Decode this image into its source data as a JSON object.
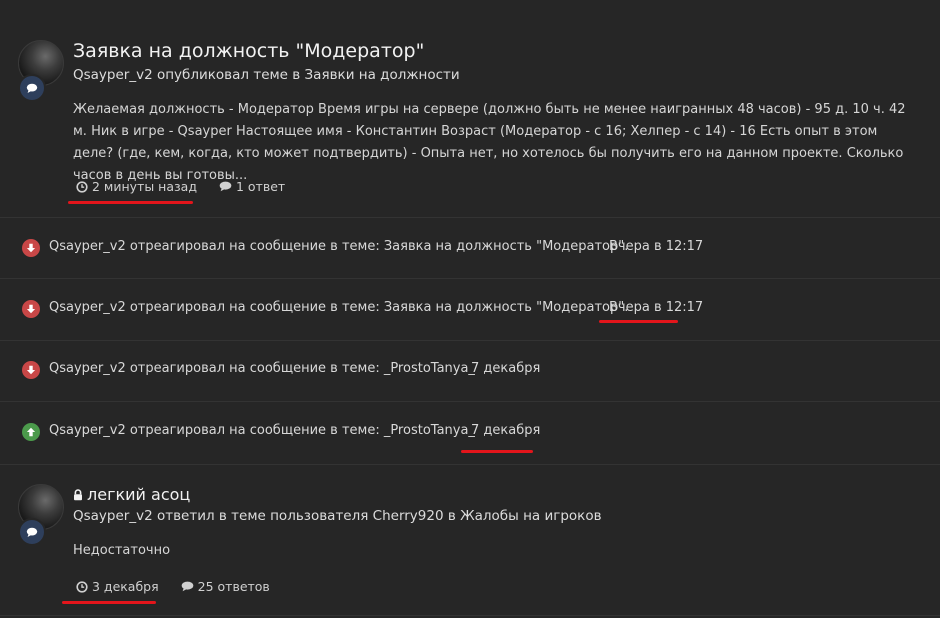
{
  "posts": [
    {
      "title": "Заявка на должность \"Модератор\"",
      "subtitle": "Qsayper_v2 опубликовал теме в Заявки на должности",
      "body": "Желаемая должность - Модератор Время игры на сервере (должно быть не менее наигранных 48 часов) - 95 д. 10 ч. 42 м. Ник в игре - Qsayper Настоящее имя - Константин Возраст (Модератор - с 16; Хелпер - с 14) - 16 Есть опыт в этом деле? (где, кем, когда, кто может подтвердить) - Опыта нет, но хотелось бы получить его на данном проекте. Сколько часов в день вы готовы...",
      "time": "2 минуты назад",
      "replies": "1 ответ",
      "locked": false
    },
    {
      "title": "легкий асоц",
      "subtitle": "Qsayper_v2 ответил в теме пользователя Cherry920 в Жалобы на игроков",
      "body": "Недостаточно",
      "time": "3 декабря",
      "replies": "25 ответов",
      "locked": true
    }
  ],
  "reactions": [
    {
      "type": "down",
      "text": "Qsayper_v2 отреагировал на сообщение в теме: Заявка на должность \"Модератор\".",
      "date": "Вчера в 12:17"
    },
    {
      "type": "down",
      "text": "Qsayper_v2 отреагировал на сообщение в теме: Заявка на должность \"Модератор\".",
      "date": "Вчера в 12:17"
    },
    {
      "type": "down",
      "text": "Qsayper_v2 отреагировал на сообщение в теме: _ProstoTanya_",
      "date": "7 декабря"
    },
    {
      "type": "up",
      "text": "Qsayper_v2 отреагировал на сообщение в теме: _ProstoTanya_",
      "date": "7 декабря"
    }
  ],
  "colors": {
    "background": "#262626",
    "reaction_down": "#c84747",
    "reaction_up": "#4b9a4b",
    "highlight_underline": "#e3151b",
    "avatar_badge": "#2e3f5c"
  }
}
